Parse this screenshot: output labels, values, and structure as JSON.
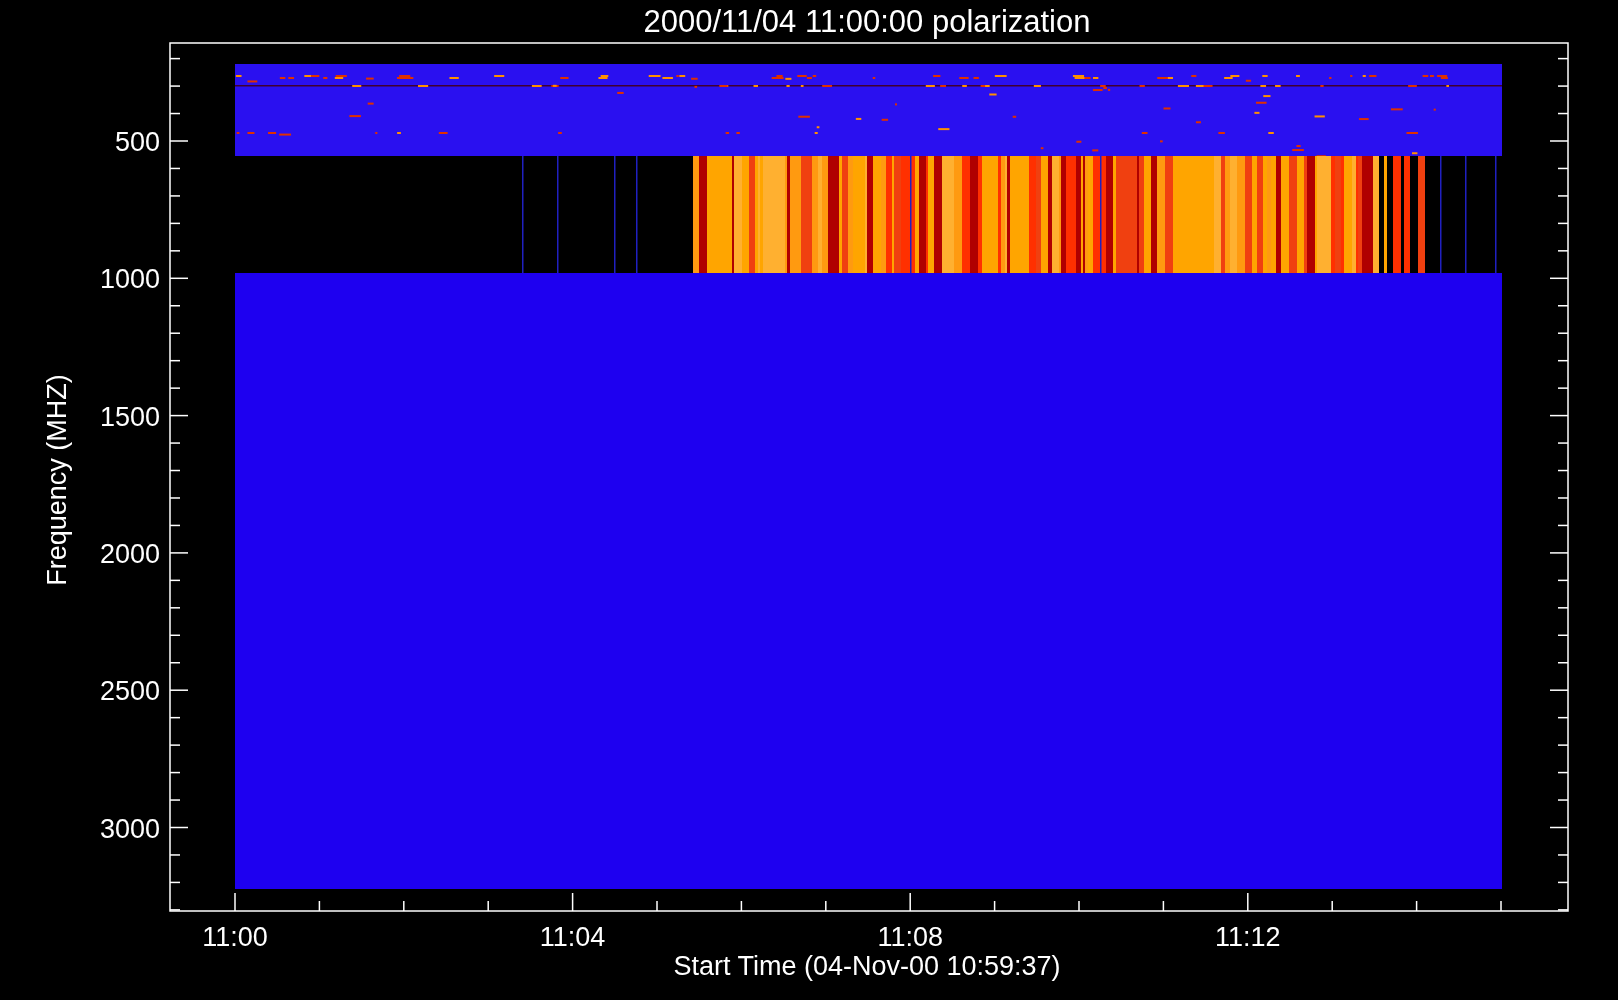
{
  "plot": {
    "title": "2000/11/04 11:00:00 polarization",
    "ylabel": "Frequency (MHZ)",
    "xlabel": "Start Time (04-Nov-00 10:59:37)",
    "yticks": [
      "500",
      "1000",
      "1500",
      "2000",
      "2500",
      "3000"
    ],
    "xticks": [
      "11:00",
      "11:04",
      "11:08",
      "11:12"
    ]
  }
}
